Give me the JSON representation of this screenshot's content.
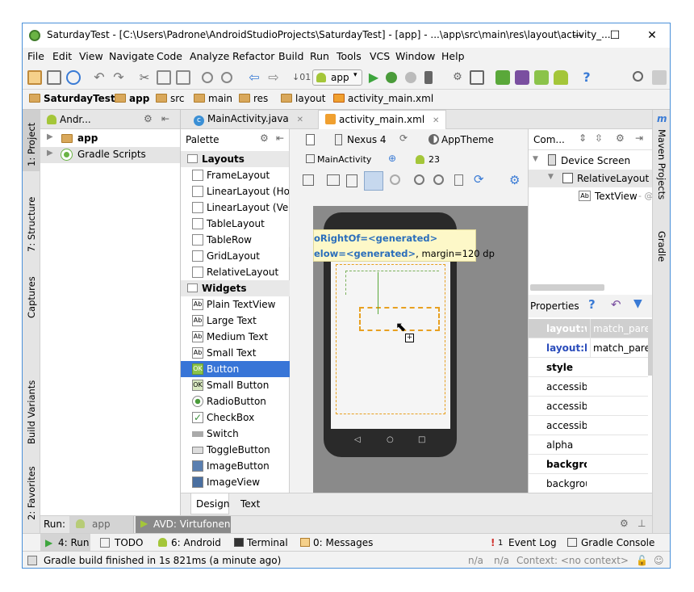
{
  "window": {
    "title": "SaturdayTest - [C:\\Users\\Padrone\\AndroidStudioProjects\\SaturdayTest] - [app] - ...\\app\\src\\main\\res\\layout\\activity_...",
    "minimize": "—",
    "maximize": "☐",
    "close": "✕"
  },
  "menu": [
    "File",
    "Edit",
    "View",
    "Navigate",
    "Code",
    "Analyze",
    "Refactor",
    "Build",
    "Run",
    "Tools",
    "VCS",
    "Window",
    "Help"
  ],
  "toolbar": {
    "run_config": "app"
  },
  "breadcrumb": [
    "SaturdayTest",
    "app",
    "src",
    "main",
    "res",
    "layout",
    "activity_main.xml"
  ],
  "left_strip": {
    "project": "1: Project",
    "structure": "7: Structure",
    "captures": "Captures",
    "build_variants": "Build Variants",
    "favorites": "2: Favorites"
  },
  "right_strip": {
    "maven": "Maven Projects",
    "gradle": "Gradle"
  },
  "project_panel": {
    "view_label": "Andr...",
    "items": [
      {
        "label": "app",
        "icon": "folder-icon"
      },
      {
        "label": "Gradle Scripts",
        "icon": "gradle-icon"
      }
    ]
  },
  "editor_tabs": [
    {
      "label": "MainActivity.java",
      "icon": "class-icon",
      "close": "✕"
    },
    {
      "label": "activity_main.xml",
      "icon": "xml-icon",
      "close": "✕"
    }
  ],
  "palette": {
    "title": "Palette",
    "sections": [
      {
        "label": "Layouts",
        "items": [
          "FrameLayout",
          "LinearLayout (Horiz",
          "LinearLayout (Vertic",
          "TableLayout",
          "TableRow",
          "GridLayout",
          "RelativeLayout"
        ]
      },
      {
        "label": "Widgets",
        "items": [
          "Plain TextView",
          "Large Text",
          "Medium Text",
          "Small Text",
          "Button",
          "Small Button",
          "RadioButton",
          "CheckBox",
          "Switch",
          "ToggleButton",
          "ImageButton",
          "ImageView"
        ]
      }
    ],
    "selected": "Button"
  },
  "designer_toolbar": {
    "device": "Nexus 4",
    "theme": "AppTheme",
    "activity": "MainActivity",
    "api": "23"
  },
  "canvas": {
    "tooltip_line1": "oRightOf=<generated>",
    "tooltip_line2_bold": "elow=<generated>",
    "tooltip_line2_rest": ", margin=120 dp"
  },
  "component_tree": {
    "title": "Com...",
    "items": [
      {
        "label": "Device Screen",
        "icon": "device-icon"
      },
      {
        "label": "RelativeLayout",
        "icon": "relative-layout-icon"
      },
      {
        "label": "TextView",
        "suffix": "- @s",
        "icon": "textview-icon"
      }
    ]
  },
  "properties": {
    "title": "Properties",
    "rows": [
      {
        "key": "layout:wi",
        "value": "match_paren",
        "style": "highlight"
      },
      {
        "key": "layout:he",
        "value": "match_paren",
        "style": "blue"
      },
      {
        "key": "style",
        "value": "",
        "style": "bold"
      },
      {
        "key": "accessibil",
        "value": "",
        "style": "normal"
      },
      {
        "key": "accessibil",
        "value": "",
        "style": "normal"
      },
      {
        "key": "accessibil",
        "value": "",
        "style": "normal"
      },
      {
        "key": "alpha",
        "value": "",
        "style": "normal"
      },
      {
        "key": "backgrou",
        "value": "",
        "style": "bold"
      },
      {
        "key": "backgrou",
        "value": "",
        "style": "normal"
      }
    ]
  },
  "design_tabs": [
    "Design",
    "Text"
  ],
  "run_bar": {
    "label": "Run:",
    "app": "app",
    "avd": "AVD: Virtufonen"
  },
  "bottom_tools": {
    "run": "4: Run",
    "todo": "TODO",
    "android": "6: Android",
    "terminal": "Terminal",
    "messages": "0: Messages",
    "event_log": "Event Log",
    "event_count": "1",
    "gradle_console": "Gradle Console"
  },
  "status": {
    "message": "Gradle build finished in 1s 821ms (a minute ago)",
    "na1": "n/a",
    "na2": "n/a",
    "context": "Context: <no context>"
  },
  "colors": {
    "selection": "#3875d7",
    "android_green": "#a4c639",
    "run_green": "#4caf50",
    "tooltip_bg": "#fdf8c8",
    "blue_text": "#2a6ebb",
    "dashed_orange": "#e8a020"
  }
}
